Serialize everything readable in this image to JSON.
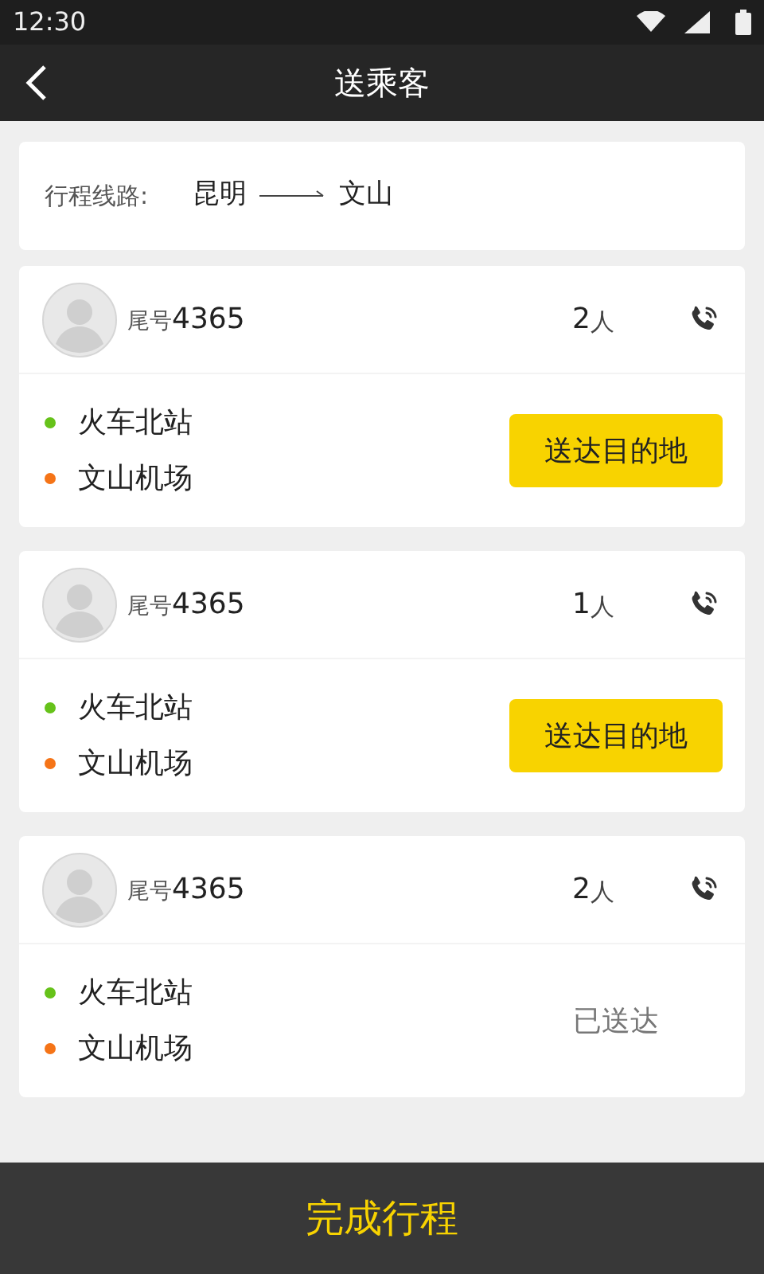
{
  "status_bar": {
    "time": "12:30"
  },
  "header": {
    "title": "送乘客"
  },
  "route": {
    "label": "行程线路:",
    "from": "昆明",
    "to": "文山"
  },
  "passengers": [
    {
      "tail_label": "尾号",
      "tail_number": "4365",
      "count": "2",
      "count_unit": "人",
      "stops": [
        {
          "name": "火车北站",
          "color": "#66c21a"
        },
        {
          "name": "文山机场",
          "color": "#f57417"
        }
      ],
      "action": {
        "kind": "button",
        "label": "送达目的地"
      }
    },
    {
      "tail_label": "尾号",
      "tail_number": "4365",
      "count": "1",
      "count_unit": "人",
      "stops": [
        {
          "name": "火车北站",
          "color": "#66c21a"
        },
        {
          "name": "文山机场",
          "color": "#f57417"
        }
      ],
      "action": {
        "kind": "button",
        "label": "送达目的地"
      }
    },
    {
      "tail_label": "尾号",
      "tail_number": "4365",
      "count": "2",
      "count_unit": "人",
      "stops": [
        {
          "name": "火车北站",
          "color": "#66c21a"
        },
        {
          "name": "文山机场",
          "color": "#f57417"
        }
      ],
      "action": {
        "kind": "status",
        "label": "已送达"
      }
    }
  ],
  "footer": {
    "label": "完成行程"
  }
}
